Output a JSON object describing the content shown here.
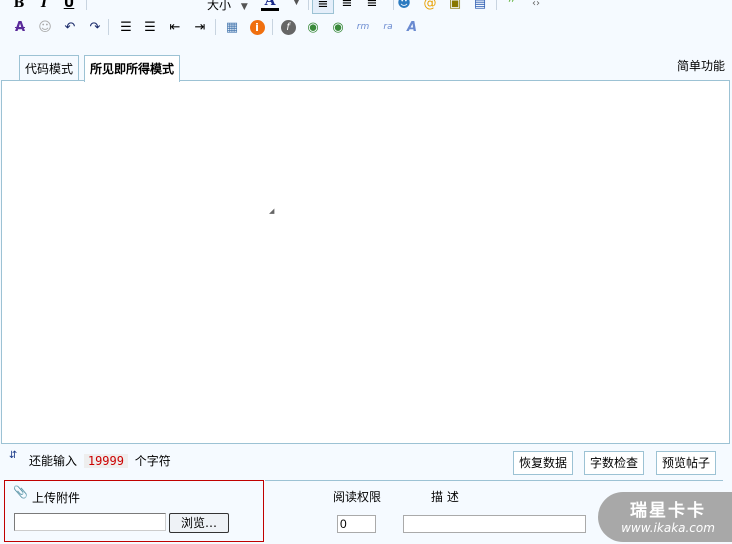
{
  "toolbar": {
    "row1": [
      {
        "name": "bold",
        "glyph": "B"
      },
      {
        "name": "italic",
        "glyph": "I"
      },
      {
        "name": "underline",
        "glyph": "U"
      }
    ],
    "font_size_label": "大小",
    "font_color_glyph": "A",
    "align_left": "≡",
    "align_center": "≡",
    "align_right": "≡",
    "row2_undo": "↶",
    "row2_redo": "↷"
  },
  "tabs": [
    {
      "label": "代码模式"
    },
    {
      "label": "所见即所得模式"
    }
  ],
  "simple_mode_label": "简单功能",
  "status": {
    "prefix": "还能输入",
    "count": "19999",
    "suffix": "个字符"
  },
  "buttons": {
    "restore": "恢复数据",
    "check": "字数检查",
    "preview": "预览帖子"
  },
  "attach": {
    "title": "上传附件",
    "browse": "浏览…",
    "read_perm_label": "阅读权限",
    "read_perm_value": "0",
    "desc_label": "描 述",
    "desc_value": ""
  },
  "watermark": {
    "brand": "瑞星卡卡",
    "url": "www.ikaka.com"
  },
  "colors": {
    "border": "#9cc2d4",
    "count": "#cc0000",
    "attach_border": "#c00000"
  }
}
